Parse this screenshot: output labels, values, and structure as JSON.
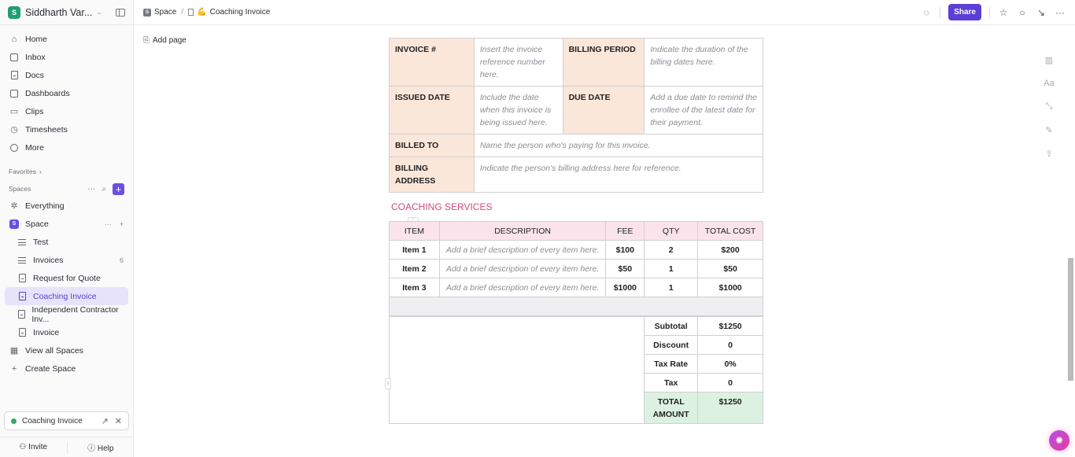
{
  "workspace": {
    "initial": "S",
    "name": "Siddharth Var...",
    "accent": "#1f9d74"
  },
  "nav": [
    {
      "label": "Home",
      "icon": "home-icon"
    },
    {
      "label": "Inbox",
      "icon": "inbox-icon"
    },
    {
      "label": "Docs",
      "icon": "docs-icon"
    },
    {
      "label": "Dashboards",
      "icon": "dashboards-icon"
    },
    {
      "label": "Clips",
      "icon": "clips-icon"
    },
    {
      "label": "Timesheets",
      "icon": "timesheets-icon"
    },
    {
      "label": "More",
      "icon": "more-icon"
    }
  ],
  "favorites_label": "Favorites",
  "spaces_label": "Spaces",
  "spaces": {
    "everything": "Everything",
    "space": {
      "initial": "S",
      "label": "Space"
    },
    "items": [
      {
        "label": "Test",
        "type": "list"
      },
      {
        "label": "Invoices",
        "type": "list",
        "count": "6"
      },
      {
        "label": "Request for Quote",
        "type": "doc"
      },
      {
        "label": "Coaching Invoice",
        "type": "doc",
        "active": true
      },
      {
        "label": "Independent Contractor Inv...",
        "type": "doc"
      },
      {
        "label": "Invoice",
        "type": "doc"
      }
    ],
    "view_all": "View all Spaces",
    "create": "Create Space"
  },
  "open_tab": {
    "label": "Coaching Invoice"
  },
  "footer": {
    "invite": "Invite",
    "help": "Help"
  },
  "breadcrumb": {
    "space": "Space",
    "space_initial": "S",
    "page": "Coaching Invoice",
    "page_emoji": "💪"
  },
  "topbar": {
    "share": "Share"
  },
  "add_page": "Add page",
  "info_table": {
    "rows": [
      {
        "l1": "INVOICE #",
        "v1": "Insert the invoice reference number here.",
        "l2": "BILLING PERIOD",
        "v2": "Indicate the duration of the billing dates here."
      },
      {
        "l1": "ISSUED DATE",
        "v1": "Include the date when this invoice is being issued here.",
        "l2": "DUE DATE",
        "v2": "Add a due date to remind the enrollee of the latest date for their payment."
      }
    ],
    "billed_to": {
      "label": "BILLED TO",
      "value": "Name the person who's paying for this invoice."
    },
    "billing_address": {
      "label": "BILLING ADDRESS",
      "value": "Indicate the person's billing address here for reference."
    }
  },
  "services": {
    "title": "COACHING SERVICES",
    "headers": [
      "ITEM",
      "DESCRIPTION",
      "FEE",
      "QTY",
      "TOTAL COST"
    ],
    "rows": [
      {
        "item": "Item 1",
        "desc": "Add a brief description of every item here.",
        "fee": "$100",
        "qty": "2",
        "total": "$200"
      },
      {
        "item": "Item 2",
        "desc": "Add a brief description of every item here.",
        "fee": "$50",
        "qty": "1",
        "total": "$50"
      },
      {
        "item": "Item 3",
        "desc": "Add a brief description of every item here.",
        "fee": "$1000",
        "qty": "1",
        "total": "$1000"
      }
    ]
  },
  "summary": [
    {
      "label": "Subtotal",
      "value": "$1250"
    },
    {
      "label": "Discount",
      "value": "0"
    },
    {
      "label": "Tax Rate",
      "value": "0%"
    },
    {
      "label": "Tax",
      "value": "0"
    },
    {
      "label": "TOTAL AMOUNT",
      "value": "$1250"
    }
  ],
  "colors": {
    "brand": "#5b3fd6",
    "label_bg": "#fbe6da",
    "header_bg": "#fbe3ec",
    "total_bg": "#dcf1e1",
    "section_title": "#d1497e"
  }
}
